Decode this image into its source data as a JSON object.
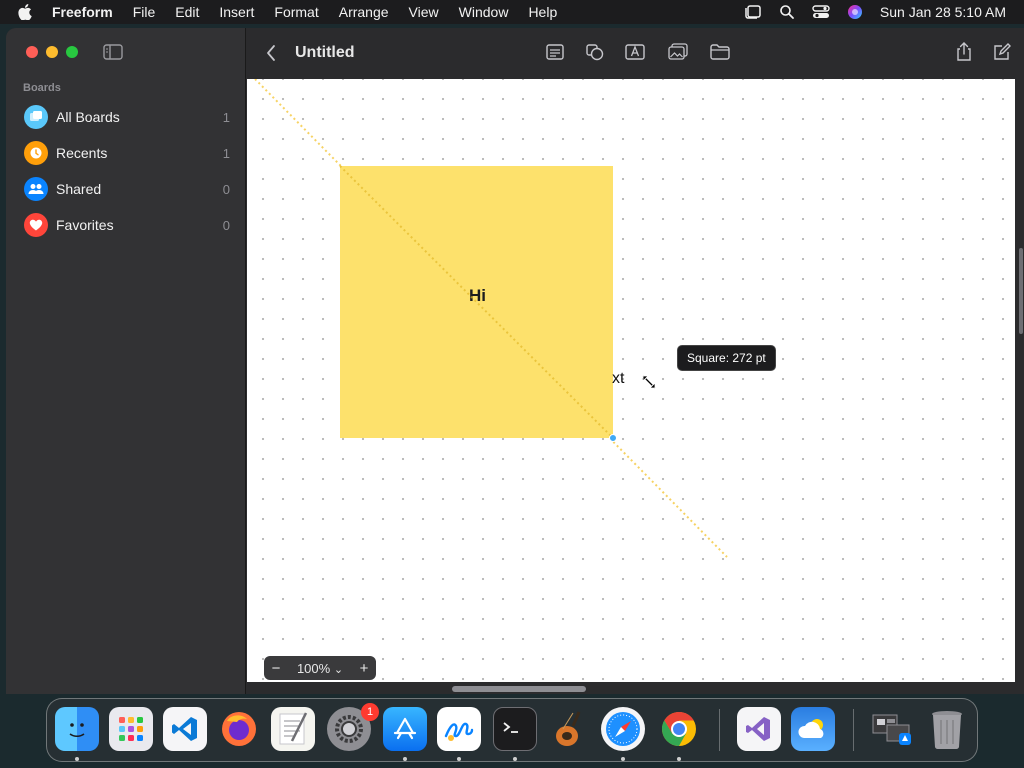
{
  "menubar": {
    "app_name": "Freeform",
    "items": [
      "File",
      "Edit",
      "Insert",
      "Format",
      "Arrange",
      "View",
      "Window",
      "Help"
    ],
    "clock": "Sun Jan 28  5:10 AM"
  },
  "sidebar": {
    "section_title": "Boards",
    "items": [
      {
        "label": "All Boards",
        "count": "1",
        "icon": "boards-icon",
        "color": "#5ac8fa"
      },
      {
        "label": "Recents",
        "count": "1",
        "icon": "clock-icon",
        "color": "#ff9f0a"
      },
      {
        "label": "Shared",
        "count": "0",
        "icon": "people-icon",
        "color": "#0a84ff"
      },
      {
        "label": "Favorites",
        "count": "0",
        "icon": "heart-icon",
        "color": "#ff453a"
      }
    ]
  },
  "toolbar": {
    "title": "Untitled"
  },
  "canvas": {
    "sticky_note_text": "Hi",
    "partial_text": "xt",
    "tooltip": "Square: 272 pt",
    "sticky_color": "#fde16c"
  },
  "zoom": {
    "value": "100%",
    "minus": "−",
    "plus": "+",
    "chevron": "⌄"
  },
  "dock": {
    "settings_badge": "1",
    "apps": [
      "finder-icon",
      "launchpad-icon",
      "vscode-icon",
      "firefox-icon",
      "textedit-icon",
      "system-settings-icon",
      "app-store-icon",
      "freeform-icon",
      "terminal-icon",
      "garageband-icon",
      "safari-icon",
      "chrome-icon",
      "visual-studio-icon",
      "weather-icon",
      "downloads-stack-icon",
      "trash-icon"
    ]
  }
}
